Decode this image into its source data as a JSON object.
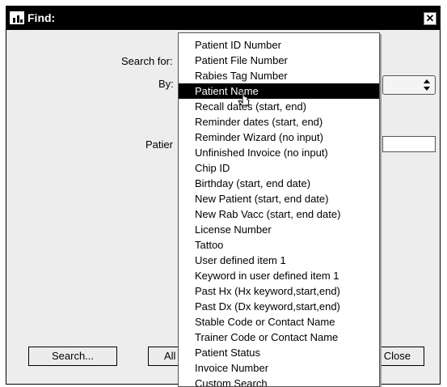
{
  "window": {
    "title": "Find:"
  },
  "form": {
    "search_for_label": "Search for:",
    "by_label": "By:",
    "patient_label": "Patier"
  },
  "buttons": {
    "search": "Search...",
    "all": "All r",
    "close": "Close"
  },
  "dropdown": {
    "selected_index": 3,
    "items": [
      {
        "label": "Patient ID Number"
      },
      {
        "label": "Patient File Number"
      },
      {
        "label": "Rabies Tag Number"
      },
      {
        "label": "Patient Name"
      },
      {
        "label": "Recall dates (start, end)"
      },
      {
        "label": "Reminder dates (start, end)"
      },
      {
        "label": "Reminder Wizard (no input)"
      },
      {
        "label": "Unfinished Invoice (no input)"
      },
      {
        "label": "Chip ID"
      },
      {
        "label": "Birthday (start, end date)"
      },
      {
        "label": "New Patient (start, end date)"
      },
      {
        "label": "New Rab Vacc (start, end date)"
      },
      {
        "label": "License Number"
      },
      {
        "label": "Tattoo"
      },
      {
        "label": "User defined item 1"
      },
      {
        "label": "Keyword in user defined item 1"
      },
      {
        "label": "Past Hx (Hx keyword,start,end)"
      },
      {
        "label": "Past Dx (Dx keyword,start,end)"
      },
      {
        "label": "Stable Code or Contact Name"
      },
      {
        "label": "Trainer Code or Contact Name"
      },
      {
        "label": "Patient Status"
      },
      {
        "label": "Invoice Number"
      },
      {
        "label": "Custom Search"
      }
    ]
  },
  "icons": {
    "title": "chart-window-icon",
    "close": "close-icon",
    "select_arrows": "up-down-arrows-icon",
    "cursor": "mouse-pointer-icon"
  },
  "colors": {
    "titlebar": "#000000",
    "window_bg": "#ededed",
    "highlight": "#000000"
  }
}
